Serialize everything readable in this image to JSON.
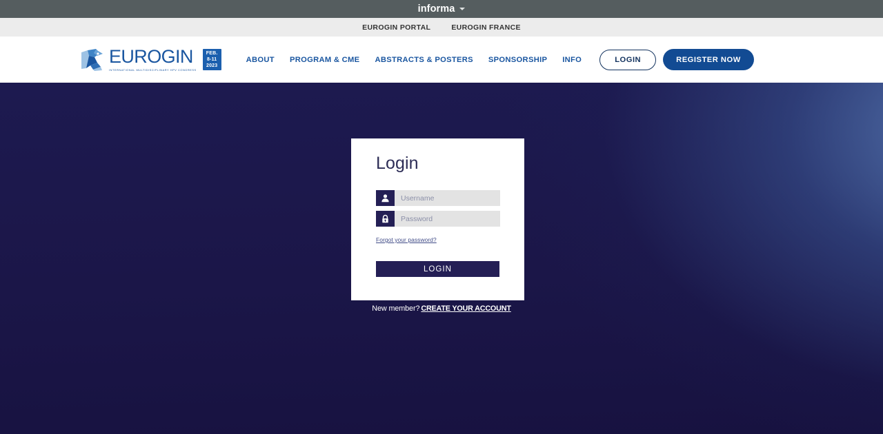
{
  "informa_bar": {
    "brand": "informa",
    "caret_icon": "chevron-down-icon"
  },
  "portal_bar": {
    "links": [
      {
        "label": "EUROGIN PORTAL"
      },
      {
        "label": "EUROGIN FRANCE"
      }
    ]
  },
  "header": {
    "logo": {
      "mark_icon": "eurogin-bird-logo-icon",
      "word": "EUROGIN",
      "tagline": "INTERNATIONAL MULTIDISCIPLINARY HPV CONGRESS",
      "date_badge": {
        "month": "FEB.",
        "days": "8-11",
        "year": "2023"
      }
    },
    "nav": [
      {
        "label": "ABOUT"
      },
      {
        "label": "PROGRAM & CME"
      },
      {
        "label": "ABSTRACTS & POSTERS"
      },
      {
        "label": "SPONSORSHIP"
      },
      {
        "label": "INFO"
      }
    ],
    "login_button": "LOGIN",
    "register_button": "REGISTER NOW"
  },
  "login_card": {
    "title": "Login",
    "username": {
      "icon": "user-icon",
      "placeholder": "Username",
      "value": ""
    },
    "password": {
      "icon": "lock-icon",
      "placeholder": "Password",
      "value": ""
    },
    "forgot_link": "Forgot your password?",
    "submit_button": "LOGIN"
  },
  "new_member": {
    "label": "New member?",
    "create_link": "CREATE YOUR ACCOUNT"
  },
  "colors": {
    "informa_bar_bg": "#555d5f",
    "portal_bar_bg": "#ececec",
    "brand_blue": "#1a56a0",
    "register_blue": "#124b93",
    "card_navy": "#241f55",
    "hero_navy": "#1b1648",
    "input_gray": "#e3e3e3"
  }
}
